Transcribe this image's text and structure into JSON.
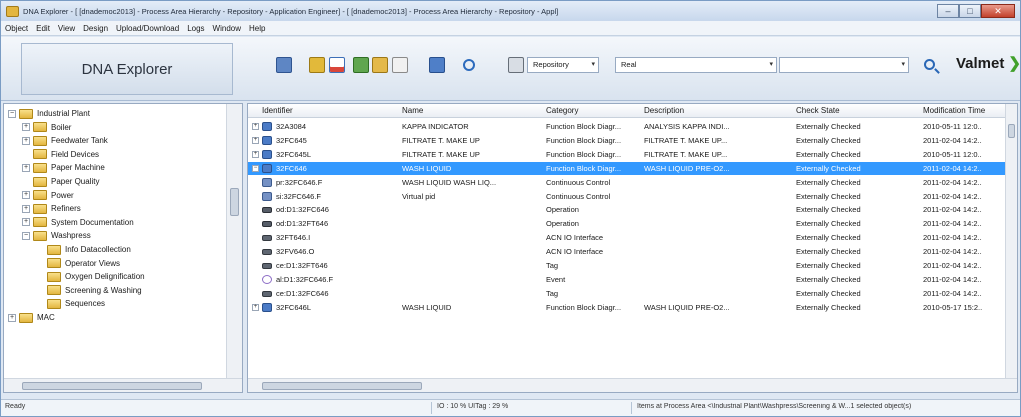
{
  "window": {
    "title": "DNA Explorer - [ [dnademoc2013] - Process Area Hierarchy - Repository - Application Engineer] - [ [dnademoc2013] - Process Area Hierarchy - Repository - Appl]",
    "min_label": "–",
    "max_label": "□",
    "close_label": "✕"
  },
  "menu": [
    "Object",
    "Edit",
    "View",
    "Design",
    "Upload/Download",
    "Logs",
    "Window",
    "Help"
  ],
  "brand": {
    "title": "DNA Explorer",
    "logo": "Valmet",
    "logo_chevron": "❯"
  },
  "toolbar": {
    "repository_combo": "Repository",
    "real_combo": "Real",
    "search_value": "",
    "combo_arrow": "▾",
    "icons": [
      "grid-view-icon",
      "open-folder-icon",
      "check-document-icon",
      "refresh-icon",
      "edit-folder-icon",
      "building-icon",
      "document-icon",
      "magnify-icon",
      "printer-icon",
      "search-icon"
    ]
  },
  "tree": [
    {
      "label": "Industrial Plant",
      "indent": 0,
      "expander": "−"
    },
    {
      "label": "Boiler",
      "indent": 1,
      "expander": "+"
    },
    {
      "label": "Feedwater Tank",
      "indent": 1,
      "expander": "+"
    },
    {
      "label": "Field Devices",
      "indent": 1,
      "expander": ""
    },
    {
      "label": "Paper Machine",
      "indent": 1,
      "expander": "+"
    },
    {
      "label": "Paper Quality",
      "indent": 1,
      "expander": ""
    },
    {
      "label": "Power",
      "indent": 1,
      "expander": "+"
    },
    {
      "label": "Refiners",
      "indent": 1,
      "expander": "+"
    },
    {
      "label": "System Documentation",
      "indent": 1,
      "expander": "+"
    },
    {
      "label": "Washpress",
      "indent": 1,
      "expander": "−"
    },
    {
      "label": "Info Datacollection",
      "indent": 2,
      "expander": ""
    },
    {
      "label": "Operator Views",
      "indent": 2,
      "expander": ""
    },
    {
      "label": "Oxygen Delignification",
      "indent": 2,
      "expander": ""
    },
    {
      "label": "Screening & Washing",
      "indent": 2,
      "expander": ""
    },
    {
      "label": "Sequences",
      "indent": 2,
      "expander": ""
    },
    {
      "label": "MAC",
      "indent": 0,
      "expander": "+"
    }
  ],
  "list": {
    "columns": [
      "Identifier",
      "Name",
      "Category",
      "Description",
      "Check State",
      "Modification Time"
    ],
    "rows": [
      {
        "exp": "+",
        "icon": "func",
        "id": "32A3084",
        "name": "KAPPA INDICATOR",
        "category": "Function Block Diagr...",
        "desc": "ANALYSIS KAPPA INDI...",
        "check": "Externally Checked",
        "time": "2010-05-11 12:0..",
        "selected": false
      },
      {
        "exp": "+",
        "icon": "func",
        "id": "32FC645",
        "name": "FILTRATE T. MAKE UP",
        "category": "Function Block Diagr...",
        "desc": "FILTRATE T. MAKE UP...",
        "check": "Externally Checked",
        "time": "2011-02-04 14:2..",
        "selected": false
      },
      {
        "exp": "+",
        "icon": "func",
        "id": "32FC645L",
        "name": "FILTRATE T. MAKE UP",
        "category": "Function Block Diagr...",
        "desc": "FILTRATE T. MAKE UP...",
        "check": "Externally Checked",
        "time": "2010-05-11 12:0..",
        "selected": false
      },
      {
        "exp": "−",
        "icon": "func",
        "id": "32FC646",
        "name": "WASH LIQUID",
        "category": "Function Block Diagr...",
        "desc": "WASH LIQUID PRE-O2...",
        "check": "Externally Checked",
        "time": "2011-02-04 14:2..",
        "selected": true
      },
      {
        "exp": "",
        "icon": "cc",
        "id": "pr:32FC646.F",
        "name": "WASH LIQUID WASH LIQ...",
        "category": "Continuous Control",
        "desc": "",
        "check": "Externally Checked",
        "time": "2011-02-04 14:2..",
        "selected": false
      },
      {
        "exp": "",
        "icon": "cc",
        "id": "si:32FC646.F",
        "name": "Virtual pid",
        "category": "Continuous Control",
        "desc": "",
        "check": "Externally Checked",
        "time": "2011-02-04 14:2..",
        "selected": false
      },
      {
        "exp": "",
        "icon": "op",
        "id": "od:D1:32FC646",
        "name": "",
        "category": "Operation",
        "desc": "",
        "check": "Externally Checked",
        "time": "2011-02-04 14:2..",
        "selected": false
      },
      {
        "exp": "",
        "icon": "op",
        "id": "od:D1:32FT646",
        "name": "",
        "category": "Operation",
        "desc": "",
        "check": "Externally Checked",
        "time": "2011-02-04 14:2..",
        "selected": false
      },
      {
        "exp": "",
        "icon": "aon",
        "id": "32FT646.I",
        "name": "",
        "category": "ACN IO Interface",
        "desc": "",
        "check": "Externally Checked",
        "time": "2011-02-04 14:2..",
        "selected": false
      },
      {
        "exp": "",
        "icon": "aon",
        "id": "32FV646.O",
        "name": "",
        "category": "ACN IO Interface",
        "desc": "",
        "check": "Externally Checked",
        "time": "2011-02-04 14:2..",
        "selected": false
      },
      {
        "exp": "",
        "icon": "aon",
        "id": "ce:D1:32FT646",
        "name": "",
        "category": "Tag",
        "desc": "",
        "check": "Externally Checked",
        "time": "2011-02-04 14:2..",
        "selected": false
      },
      {
        "exp": "",
        "icon": "event",
        "id": "al:D1:32FC646.F",
        "name": "",
        "category": "Event",
        "desc": "",
        "check": "Externally Checked",
        "time": "2011-02-04 14:2..",
        "selected": false
      },
      {
        "exp": "",
        "icon": "aon",
        "id": "ce:D1:32FC646",
        "name": "",
        "category": "Tag",
        "desc": "",
        "check": "Externally Checked",
        "time": "2011-02-04 14:2..",
        "selected": false
      },
      {
        "exp": "+",
        "icon": "func",
        "id": "32FC646L",
        "name": "WASH LIQUID",
        "category": "Function Block Diagr...",
        "desc": "WASH LIQUID PRE-O2...",
        "check": "Externally Checked",
        "time": "2010-05-17 15:2..",
        "selected": false
      }
    ]
  },
  "status": {
    "left": "Ready",
    "middle": "IO : 10 % UITag : 29 %",
    "right": "Items at Process Area <\\Industrial Plant\\Washpress\\Screening & W...1 selected object(s)"
  }
}
